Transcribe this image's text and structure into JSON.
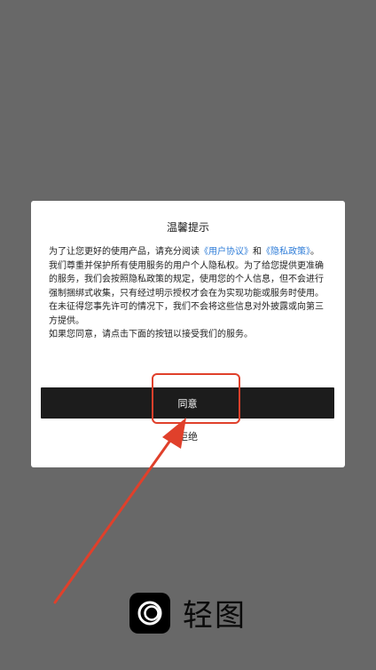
{
  "dialog": {
    "title": "温馨提示",
    "intro_prefix": "为了让您更好的使用产品，请充分阅读",
    "user_agreement_link": "《用户协议》",
    "conjunction": "和",
    "privacy_policy_link": "《隐私政策》",
    "intro_suffix": "。",
    "paragraph_2": "我们尊重并保护所有使用服务的用户个人隐私权。为了给您提供更准确的服务，我们会按照隐私政策的规定，使用您的个人信息，但不会进行强制捆绑式收集，只有经过明示授权才会在为实现功能或服务时使用。在未征得您事先许可的情况下，我们不会将这些信息对外披露或向第三方提供。",
    "paragraph_3": "如果您同意，请点击下面的按钮以接受我们的服务。",
    "agree_label": "同意",
    "reject_label": "拒绝"
  },
  "brand": {
    "name": "轻图"
  },
  "colors": {
    "overlay": "#686868",
    "link": "#2f7dd8",
    "button": "#1c1c1c",
    "annotation": "#e0402b"
  }
}
